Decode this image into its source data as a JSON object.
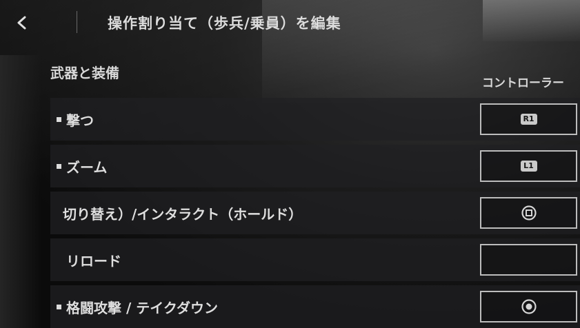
{
  "header": {
    "title": "操作割り当て（歩兵/乗員）を編集"
  },
  "section": {
    "title": "武器と装備",
    "column_header": "コントローラー"
  },
  "rows": [
    {
      "label": "撃つ",
      "binding": "R1",
      "binding_icon": "r1-badge-icon",
      "bullet": true
    },
    {
      "label": "ズーム",
      "binding": "L1",
      "binding_icon": "l1-badge-icon",
      "bullet": true
    },
    {
      "label": "切り替え）/インタラクト（ホールド）",
      "binding": "",
      "binding_icon": "square-button-icon",
      "bullet": false
    },
    {
      "label": "リロード",
      "binding": "",
      "binding_icon": "",
      "bullet": false
    },
    {
      "label": "格闘攻撃 / テイクダウン",
      "binding": "",
      "binding_icon": "circle-button-icon",
      "bullet": true
    }
  ]
}
